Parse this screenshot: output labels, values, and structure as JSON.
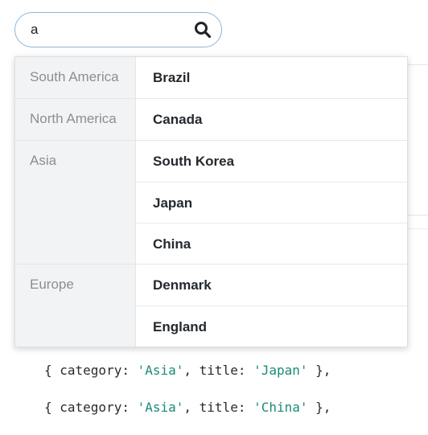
{
  "search": {
    "value": "a",
    "icon": "search-icon"
  },
  "groups": [
    {
      "label": "South America",
      "items": [
        "Brazil"
      ]
    },
    {
      "label": "North America",
      "items": [
        "Canada"
      ]
    },
    {
      "label": "Asia",
      "items": [
        "South Korea",
        "Japan",
        "China"
      ]
    },
    {
      "label": "Europe",
      "items": [
        "Denmark",
        "England"
      ]
    }
  ],
  "code": {
    "line1": {
      "prefix": "{ category: ",
      "cat": "'Asia'",
      "mid": ", title: ",
      "title": "'Japan'",
      "suffix": " },"
    },
    "line2": {
      "prefix": "{ category: ",
      "cat": "'Asia'",
      "mid": ", title: ",
      "title": "'China'",
      "suffix": " },"
    }
  }
}
